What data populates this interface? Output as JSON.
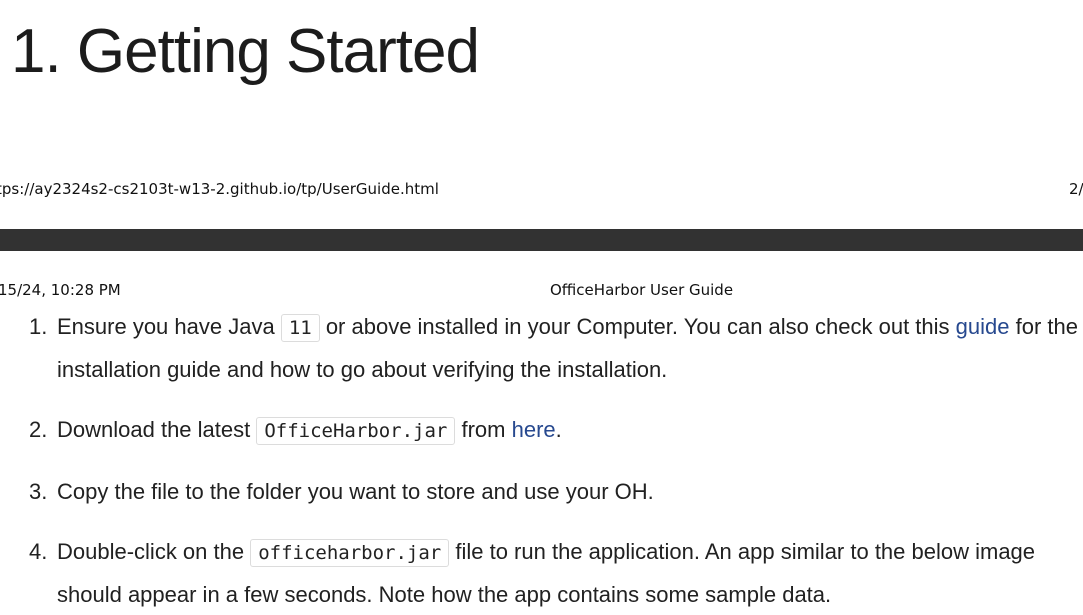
{
  "heading": "1. Getting Started",
  "print_footer": {
    "url": "tps://ay2324s2-cs2103t-w13-2.github.io/tp/UserGuide.html",
    "page": "2/"
  },
  "print_header": {
    "datetime": "15/24, 10:28 PM",
    "title": "OfficeHarbor User Guide"
  },
  "colors": {
    "link": "#27498f",
    "page_break": "#323232"
  },
  "steps": [
    {
      "number": "1.",
      "t1": "Ensure you have Java ",
      "code": "11",
      "t2": " or above installed in your Computer. You can also check out this ",
      "link": "guide",
      "t3": " for the installation guide and how to go about verifying the installation."
    },
    {
      "number": "2.",
      "t1": "Download the latest ",
      "code": "OfficeHarbor.jar",
      "t2": " from ",
      "link": "here",
      "t3": "."
    },
    {
      "number": "3.",
      "t1": "Copy the file to the folder you want to store and use your OH."
    },
    {
      "number": "4.",
      "t1": "Double-click on the ",
      "code": "officeharbor.jar",
      "t2": " file to run the application. An app similar to the below image should appear in a few seconds. Note how the app contains some sample data."
    }
  ]
}
